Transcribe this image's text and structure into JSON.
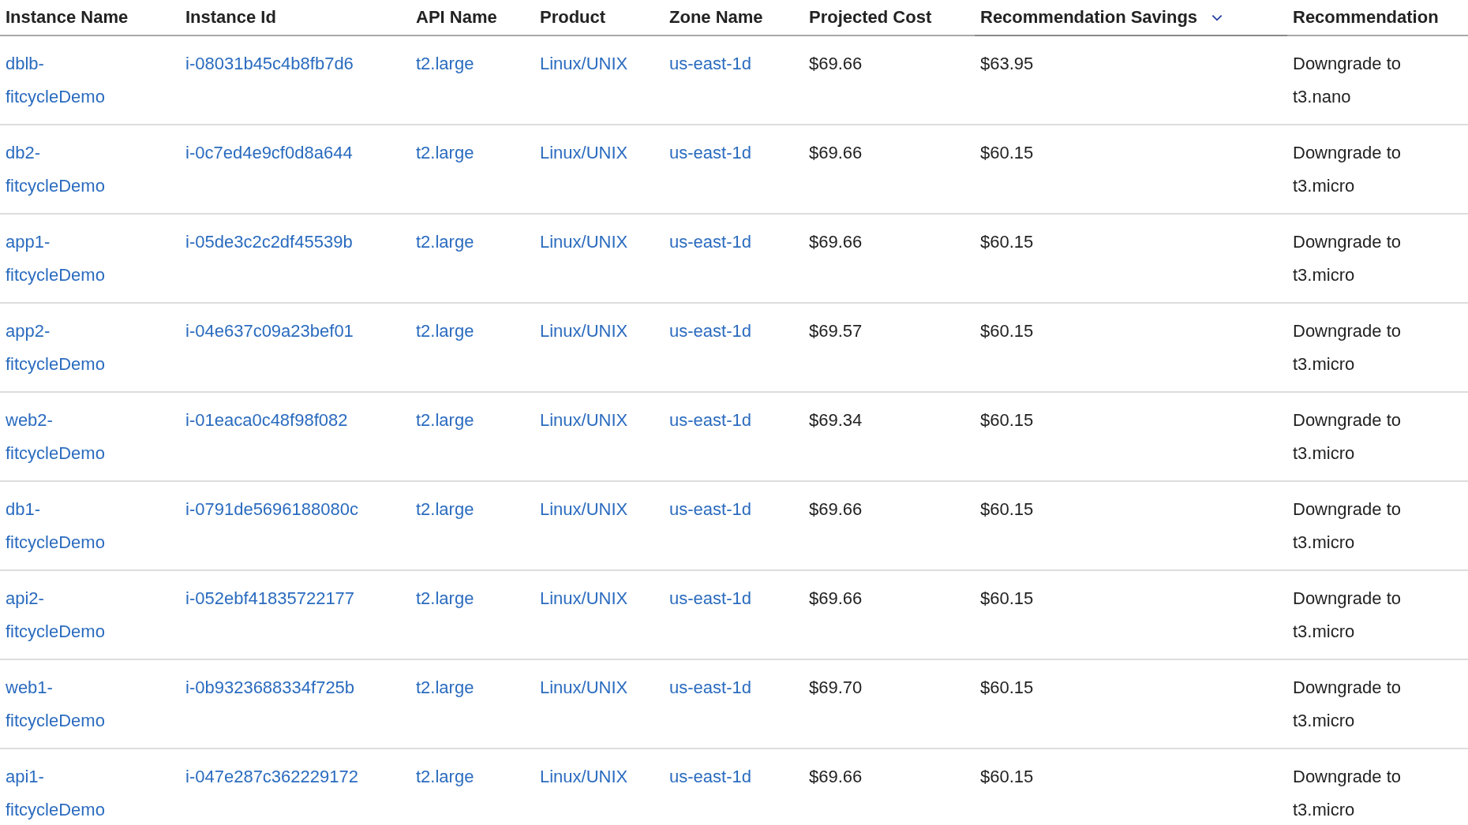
{
  "table": {
    "columns": [
      {
        "label": "Instance Name",
        "sorted": false
      },
      {
        "label": "Instance Id",
        "sorted": false
      },
      {
        "label": "API Name",
        "sorted": false
      },
      {
        "label": "Product",
        "sorted": false
      },
      {
        "label": "Zone Name",
        "sorted": false
      },
      {
        "label": "Projected Cost",
        "sorted": false
      },
      {
        "label": "Recommendation Savings",
        "sorted": true
      },
      {
        "label": "Recommendation",
        "sorted": false
      }
    ],
    "rows": [
      {
        "instance_name": "dblb-fitcycleDemo",
        "instance_id": "i-08031b45c4b8fb7d6",
        "api_name": "t2.large",
        "product": "Linux/UNIX",
        "zone_name": "us-east-1d",
        "projected_cost": "$69.66",
        "recommendation_savings": "$63.95",
        "recommendation": "Downgrade to t3.nano"
      },
      {
        "instance_name": "db2-fitcycleDemo",
        "instance_id": "i-0c7ed4e9cf0d8a644",
        "api_name": "t2.large",
        "product": "Linux/UNIX",
        "zone_name": "us-east-1d",
        "projected_cost": "$69.66",
        "recommendation_savings": "$60.15",
        "recommendation": "Downgrade to t3.micro"
      },
      {
        "instance_name": "app1-fitcycleDemo",
        "instance_id": "i-05de3c2c2df45539b",
        "api_name": "t2.large",
        "product": "Linux/UNIX",
        "zone_name": "us-east-1d",
        "projected_cost": "$69.66",
        "recommendation_savings": "$60.15",
        "recommendation": "Downgrade to t3.micro"
      },
      {
        "instance_name": "app2-fitcycleDemo",
        "instance_id": "i-04e637c09a23bef01",
        "api_name": "t2.large",
        "product": "Linux/UNIX",
        "zone_name": "us-east-1d",
        "projected_cost": "$69.57",
        "recommendation_savings": "$60.15",
        "recommendation": "Downgrade to t3.micro"
      },
      {
        "instance_name": "web2-fitcycleDemo",
        "instance_id": "i-01eaca0c48f98f082",
        "api_name": "t2.large",
        "product": "Linux/UNIX",
        "zone_name": "us-east-1d",
        "projected_cost": "$69.34",
        "recommendation_savings": "$60.15",
        "recommendation": "Downgrade to t3.micro"
      },
      {
        "instance_name": "db1-fitcycleDemo",
        "instance_id": "i-0791de5696188080c",
        "api_name": "t2.large",
        "product": "Linux/UNIX",
        "zone_name": "us-east-1d",
        "projected_cost": "$69.66",
        "recommendation_savings": "$60.15",
        "recommendation": "Downgrade to t3.micro"
      },
      {
        "instance_name": "api2-fitcycleDemo",
        "instance_id": "i-052ebf41835722177",
        "api_name": "t2.large",
        "product": "Linux/UNIX",
        "zone_name": "us-east-1d",
        "projected_cost": "$69.66",
        "recommendation_savings": "$60.15",
        "recommendation": "Downgrade to t3.micro"
      },
      {
        "instance_name": "web1-fitcycleDemo",
        "instance_id": "i-0b9323688334f725b",
        "api_name": "t2.large",
        "product": "Linux/UNIX",
        "zone_name": "us-east-1d",
        "projected_cost": "$69.70",
        "recommendation_savings": "$60.15",
        "recommendation": "Downgrade to t3.micro"
      },
      {
        "instance_name": "api1-fitcycleDemo",
        "instance_id": "i-047e287c362229172",
        "api_name": "t2.large",
        "product": "Linux/UNIX",
        "zone_name": "us-east-1d",
        "projected_cost": "$69.66",
        "recommendation_savings": "$60.15",
        "recommendation": "Downgrade to t3.micro"
      }
    ]
  }
}
